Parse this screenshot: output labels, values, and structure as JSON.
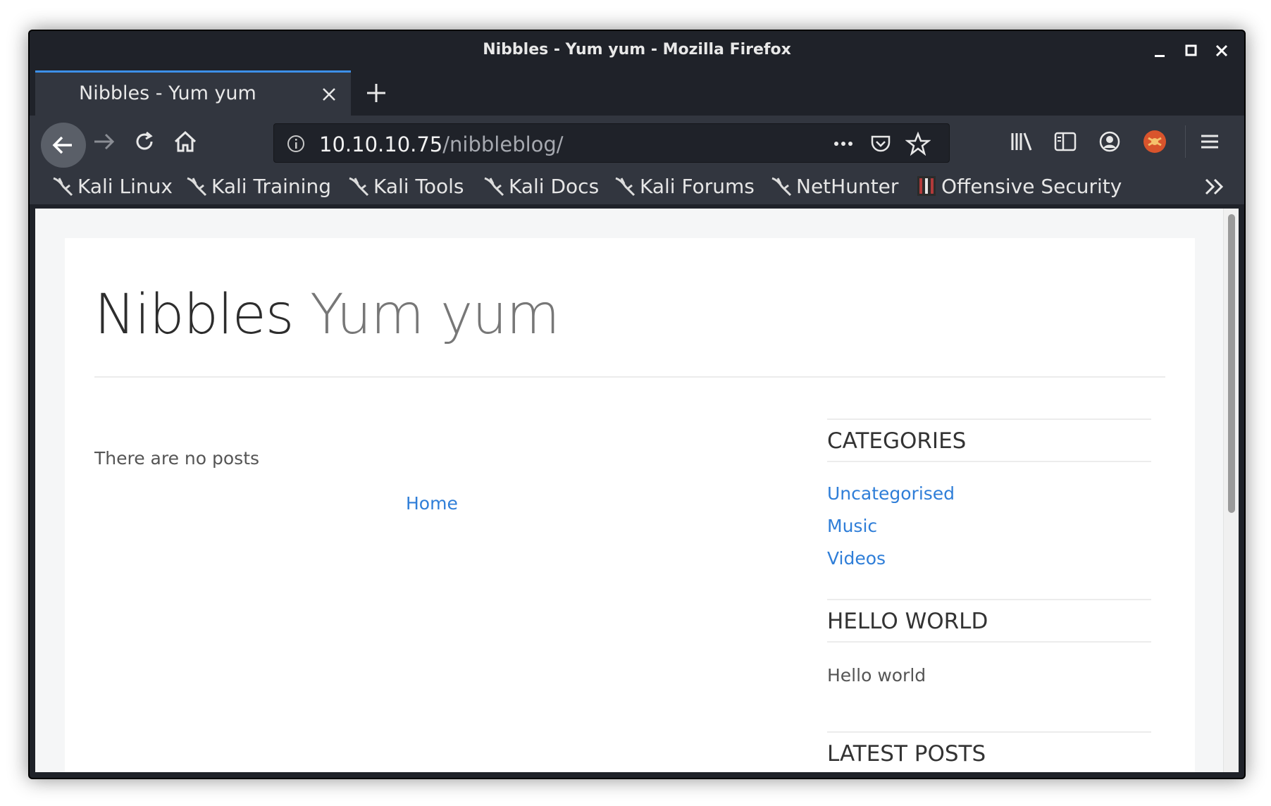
{
  "window": {
    "title": "Nibbles - Yum yum - Mozilla Firefox"
  },
  "tab": {
    "label": "Nibbles - Yum yum"
  },
  "urlbar": {
    "host": "10.10.10.75",
    "path": "/nibbleblog/"
  },
  "bookmarks": [
    {
      "label": "Kali Linux",
      "icon": "kali-dragon-icon"
    },
    {
      "label": "Kali Training",
      "icon": "kali-dragon-icon"
    },
    {
      "label": "Kali Tools",
      "icon": "kali-dragon-icon"
    },
    {
      "label": "Kali Docs",
      "icon": "kali-dragon-icon"
    },
    {
      "label": "Kali Forums",
      "icon": "kali-dragon-icon"
    },
    {
      "label": "NetHunter",
      "icon": "kali-dragon-icon"
    },
    {
      "label": "Offensive Security",
      "icon": "offsec-icon"
    }
  ],
  "blog": {
    "name": "Nibbles",
    "slogan": "Yum yum",
    "no_posts": "There are no posts",
    "home_link": "Home"
  },
  "sidebar": {
    "categories": {
      "title": "CATEGORIES",
      "items": [
        "Uncategorised",
        "Music",
        "Videos"
      ]
    },
    "hello_world": {
      "title": "HELLO WORLD",
      "text": "Hello world"
    },
    "latest_posts": {
      "title": "LATEST POSTS"
    }
  },
  "colors": {
    "chrome_dark": "#1f2229",
    "chrome_mid": "#32363f",
    "tab_accent": "#3d8fe8",
    "link": "#2f7ed8"
  }
}
